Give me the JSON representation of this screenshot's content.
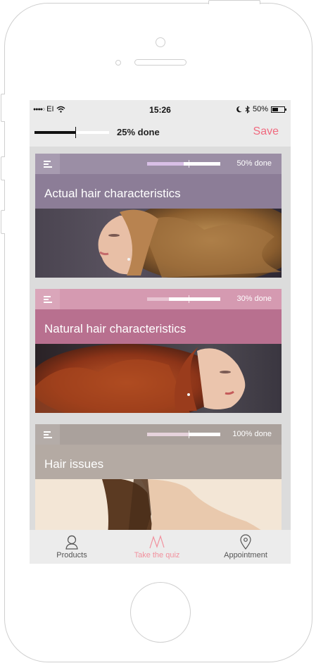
{
  "status_bar": {
    "carrier": "EI",
    "time": "15:26",
    "battery": "50%",
    "signal_dots": "●●●●○",
    "battery_level": 0.5
  },
  "quiz_progress": {
    "label": "25% done",
    "value": 0.25,
    "save_label": "Save"
  },
  "cards": [
    {
      "title": "Actual hair characteristics",
      "progress_label": "50% done",
      "progress": 0.5,
      "header_color": "#9b8ea5",
      "title_color": "#8c7d97",
      "fill_color": "#d8bfe6",
      "image": "woman-curly-blonde-hair-photo"
    },
    {
      "title": "Natural hair characteristics",
      "progress_label": "30% done",
      "progress": 0.3,
      "header_color": "#d59ab1",
      "title_color": "#b8708f",
      "fill_color": "#e7c4d2",
      "image": "woman-curly-red-hair-photo"
    },
    {
      "title": "Hair issues",
      "progress_label": "100% done",
      "progress": 1.0,
      "header_color": "#aaa19c",
      "title_color": "#b4aaa3",
      "fill_color": "#e6d3dc",
      "image": "woman-straight-brown-hair-photo"
    }
  ],
  "tabs": [
    {
      "label": "Products",
      "icon": "person-icon",
      "active": false
    },
    {
      "label": "Take the quiz",
      "icon": "quiz-icon",
      "active": true
    },
    {
      "label": "Appointment",
      "icon": "location-pin-icon",
      "active": false
    }
  ],
  "colors": {
    "accent": "#f06a7f",
    "tab_active": "#f2919e"
  }
}
